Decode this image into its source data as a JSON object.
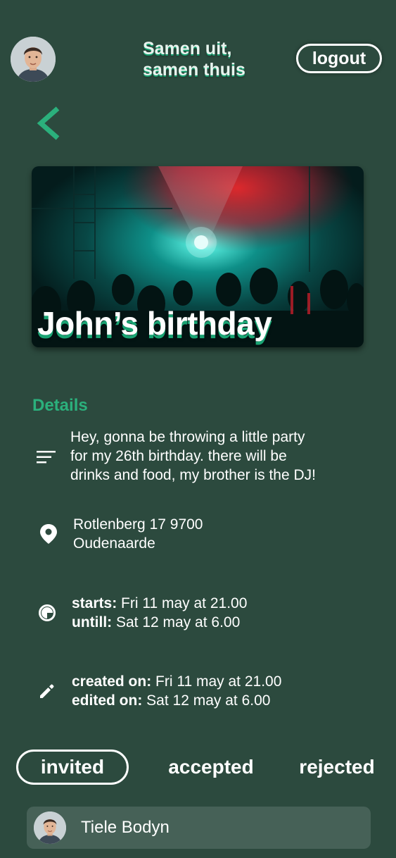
{
  "header": {
    "title_line1": "Samen uit,",
    "title_line2": "samen thuis",
    "logout_label": "logout"
  },
  "event": {
    "title": "John’s birthday"
  },
  "details": {
    "heading": "Details",
    "description_lines": [
      "Hey, gonna be throwing a little party",
      "for my 26th birthday. there will be",
      "drinks and food, my brother is the DJ!"
    ],
    "address_line1": "Rotlenberg 17 9700",
    "address_line2": "Oudenaarde",
    "starts_label": "starts:",
    "starts_value": " Fri 11 may at 21.00",
    "until_label": "untill:",
    "until_value": " Sat 12 may at 6.00",
    "created_label": "created on:",
    "created_value": " Fri 11 may at 21.00",
    "edited_label": "edited on:",
    "edited_value": " Sat 12 may at 6.00"
  },
  "tabs": {
    "invited": "invited",
    "accepted": "accepted",
    "rejected": "rejected",
    "active": "invited"
  },
  "invited_list": [
    {
      "name": "Tiele Bodyn"
    }
  ],
  "colors": {
    "background": "#2c4a3e",
    "accent": "#2bb07c",
    "row": "#466157"
  },
  "icons": {
    "back": "chevron-left-icon",
    "description": "text-lines-icon",
    "location": "map-pin-icon",
    "time": "clock-icon",
    "edit": "pencil-icon"
  }
}
